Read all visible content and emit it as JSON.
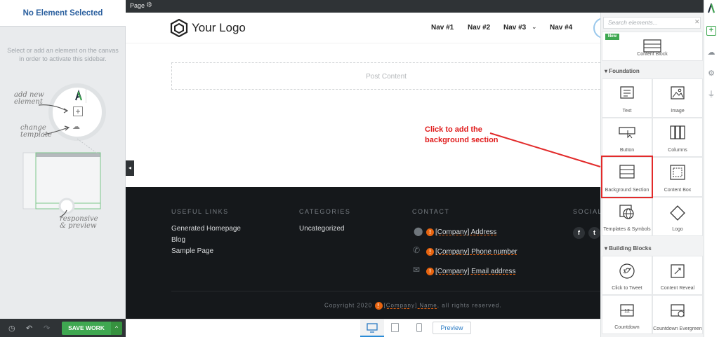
{
  "left_sidebar": {
    "title": "No Element Selected",
    "description": "Select or add an element on the canvas in order to activate this sidebar.",
    "illustration": {
      "add_new_element": "add new element",
      "change_template": "change template",
      "responsive_preview": "responsive & preview"
    },
    "save_label": "SAVE WORK"
  },
  "canvas": {
    "page_label": "Page",
    "logo_text": "Your Logo",
    "nav": [
      "Nav #1",
      "Nav #2",
      "Nav #3",
      "Nav #4"
    ],
    "post_content": "Post Content"
  },
  "footer": {
    "useful_links_heading": "USEFUL LINKS",
    "useful_links": [
      "Generated Homepage",
      "Blog",
      "Sample Page"
    ],
    "categories_heading": "CATEGORIES",
    "categories": [
      "Uncategorized"
    ],
    "contact_heading": "CONTACT",
    "contact": [
      "[Company] Address",
      "[Company] Phone number",
      "[Company] Email address"
    ],
    "social_heading": "SOCIAL",
    "copyright_pre": "Copyright 2020",
    "copyright_name": "[Company] Name",
    "copyright_post": ", all rights reserved."
  },
  "bottom_bar": {
    "preview_label": "Preview"
  },
  "elements_panel": {
    "search_placeholder": "Search elements...",
    "new_badge": "New",
    "content_block": "Content Block",
    "foundation_heading": "Foundation",
    "foundation": [
      "Text",
      "Image",
      "Button",
      "Columns",
      "Background Section",
      "Content Box",
      "Templates & Symbols",
      "Logo"
    ],
    "building_blocks_heading": "Building Blocks",
    "building_blocks": [
      "Click to Tweet",
      "Content Reveal",
      "Countdown",
      "Countdown Evergreen"
    ]
  },
  "annotation": {
    "line1": "Click to add the",
    "line2": "background section"
  },
  "colors": {
    "accent_green": "#3fa851",
    "annotation_red": "#e22b2b",
    "footer_bg": "#15181b",
    "warning_orange": "#e8640f"
  }
}
